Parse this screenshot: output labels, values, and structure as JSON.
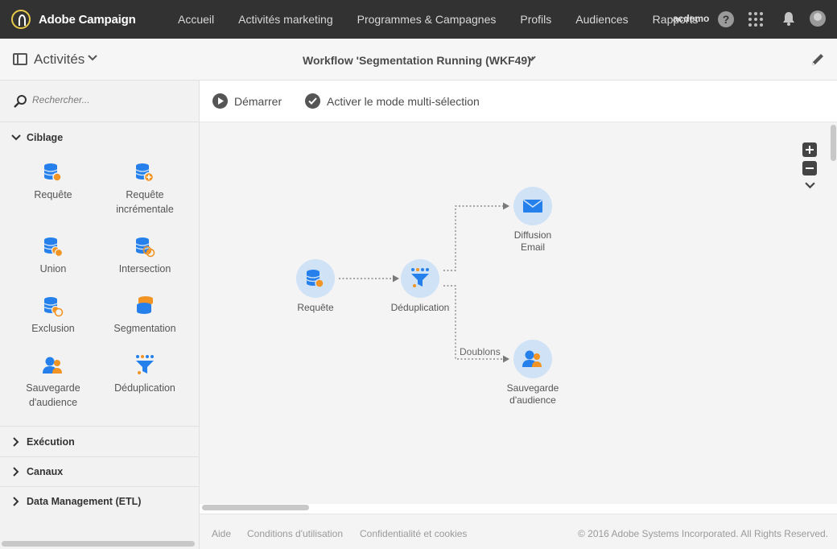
{
  "app": {
    "name": "Adobe Campaign"
  },
  "topnav": {
    "items": [
      "Accueil",
      "Activités marketing",
      "Programmes & Campagnes",
      "Profils",
      "Audiences",
      "Rapports"
    ],
    "user": "acdemo"
  },
  "subheader": {
    "panel_title": "Activités",
    "workflow_title": "Workflow 'Segmentation Running (WKF49)'"
  },
  "sidebar": {
    "search_placeholder": "Rechercher...",
    "categories": [
      {
        "label": "Ciblage",
        "expanded": true,
        "activities": [
          {
            "label": "Requête",
            "icon": "query-icon"
          },
          {
            "label": "Requête incrémentale",
            "icon": "incremental-query-icon"
          },
          {
            "label": "Union",
            "icon": "union-icon"
          },
          {
            "label": "Intersection",
            "icon": "intersection-icon"
          },
          {
            "label": "Exclusion",
            "icon": "exclusion-icon"
          },
          {
            "label": "Segmentation",
            "icon": "segmentation-icon"
          },
          {
            "label": "Sauvegarde d'audience",
            "icon": "save-audience-icon"
          },
          {
            "label": "Déduplication",
            "icon": "deduplication-icon"
          }
        ]
      },
      {
        "label": "Exécution",
        "expanded": false
      },
      {
        "label": "Canaux",
        "expanded": false
      },
      {
        "label": "Data Management (ETL)",
        "expanded": false
      }
    ]
  },
  "toolbar": {
    "start_label": "Démarrer",
    "multiselect_label": "Activer le mode multi-sélection"
  },
  "workflow": {
    "nodes": {
      "query": "Requête",
      "dedup": "Déduplication",
      "email": "Diffusion Email",
      "audience": "Sauvegarde d'audience"
    },
    "edge_label": "Doublons"
  },
  "footer": {
    "help": "Aide",
    "terms": "Conditions d'utilisation",
    "privacy": "Confidentialité et cookies",
    "copyright": "© 2016 Adobe Systems Incorporated. All Rights Reserved."
  },
  "colors": {
    "topbar": "#323232",
    "node_bg": "#cfe2f6",
    "icon_blue": "#2680eb",
    "icon_orange": "#f29423"
  }
}
